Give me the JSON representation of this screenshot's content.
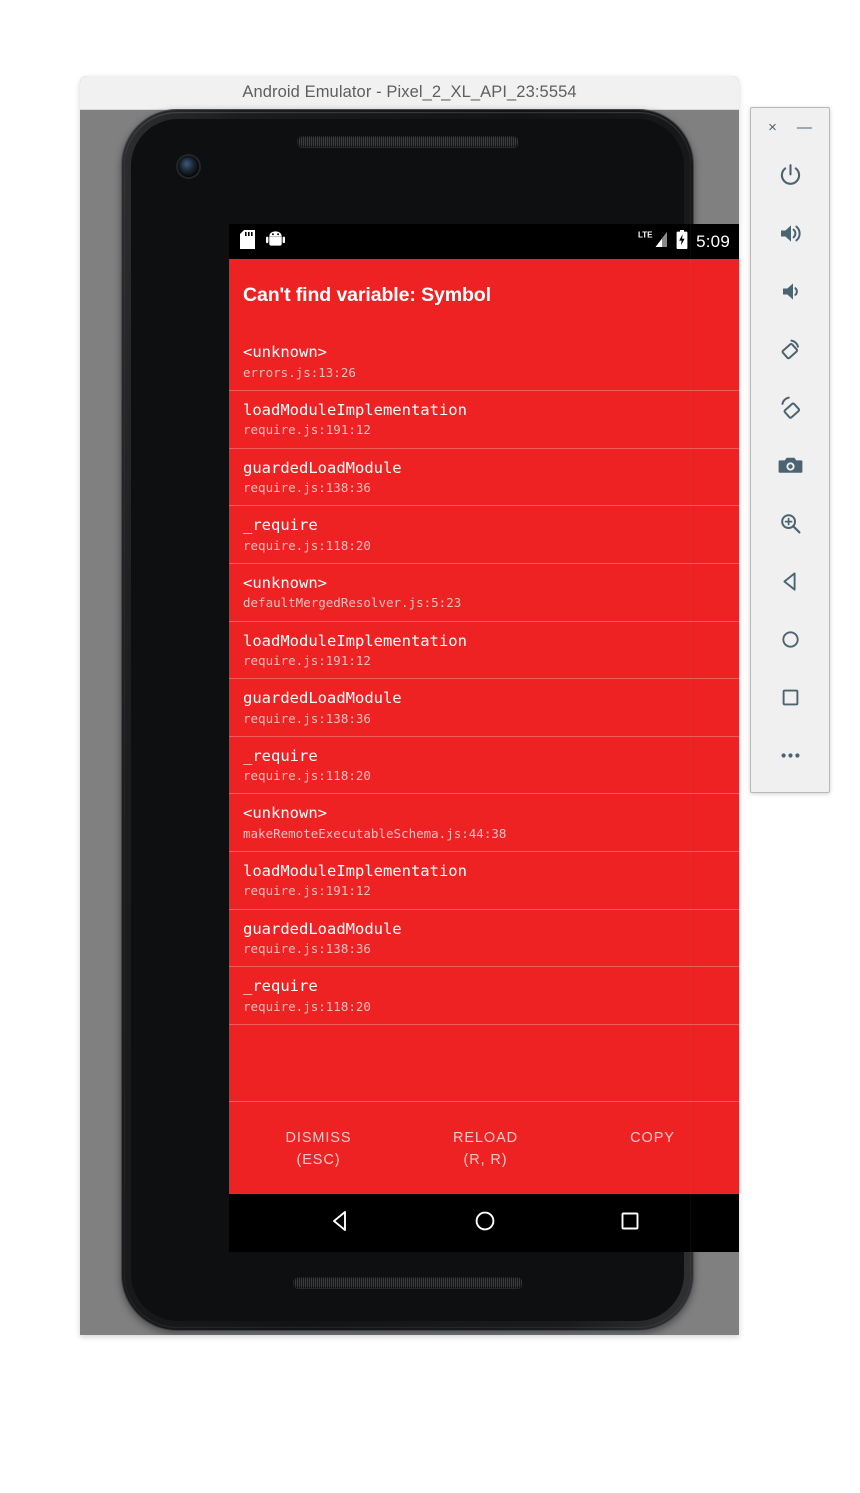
{
  "window": {
    "title": "Android Emulator - Pixel_2_XL_API_23:5554"
  },
  "statusbar": {
    "icons_left": [
      "sd-card-icon",
      "android-robot-icon"
    ],
    "network_label": "LTE",
    "icons_right": [
      "lte-signal-icon",
      "battery-charging-icon"
    ],
    "time": "5:09"
  },
  "redbox": {
    "error_title": "Can't find variable: Symbol",
    "background_color": "#ee2222",
    "separator_color": "#f25c5c",
    "location_text_color": "#f3bfbf",
    "frames": [
      {
        "name": "<unknown>",
        "location": "errors.js:13:26"
      },
      {
        "name": "loadModuleImplementation",
        "location": "require.js:191:12"
      },
      {
        "name": "guardedLoadModule",
        "location": "require.js:138:36"
      },
      {
        "name": "_require",
        "location": "require.js:118:20"
      },
      {
        "name": "<unknown>",
        "location": "defaultMergedResolver.js:5:23"
      },
      {
        "name": "loadModuleImplementation",
        "location": "require.js:191:12"
      },
      {
        "name": "guardedLoadModule",
        "location": "require.js:138:36"
      },
      {
        "name": "_require",
        "location": "require.js:118:20"
      },
      {
        "name": "<unknown>",
        "location": "makeRemoteExecutableSchema.js:44:38"
      },
      {
        "name": "loadModuleImplementation",
        "location": "require.js:191:12"
      },
      {
        "name": "guardedLoadModule",
        "location": "require.js:138:36"
      },
      {
        "name": "_require",
        "location": "require.js:118:20"
      }
    ],
    "actions": [
      {
        "label": "DISMISS",
        "shortcut": "(ESC)"
      },
      {
        "label": "RELOAD",
        "shortcut": "(R, R)"
      },
      {
        "label": "COPY",
        "shortcut": ""
      }
    ]
  },
  "navbar": {
    "buttons": [
      {
        "name": "back-icon"
      },
      {
        "name": "home-icon"
      },
      {
        "name": "overview-icon"
      }
    ]
  },
  "emulator_toolbar": {
    "close_label": "×",
    "minimize_label": "—",
    "items": [
      {
        "name": "power-icon"
      },
      {
        "name": "volume-up-icon"
      },
      {
        "name": "volume-down-icon"
      },
      {
        "name": "rotate-left-icon"
      },
      {
        "name": "rotate-right-icon"
      },
      {
        "name": "camera-screenshot-icon"
      },
      {
        "name": "zoom-in-icon"
      },
      {
        "name": "back-icon"
      },
      {
        "name": "home-icon"
      },
      {
        "name": "overview-icon"
      },
      {
        "name": "more-icon"
      }
    ],
    "icon_color": "#4c6472"
  }
}
